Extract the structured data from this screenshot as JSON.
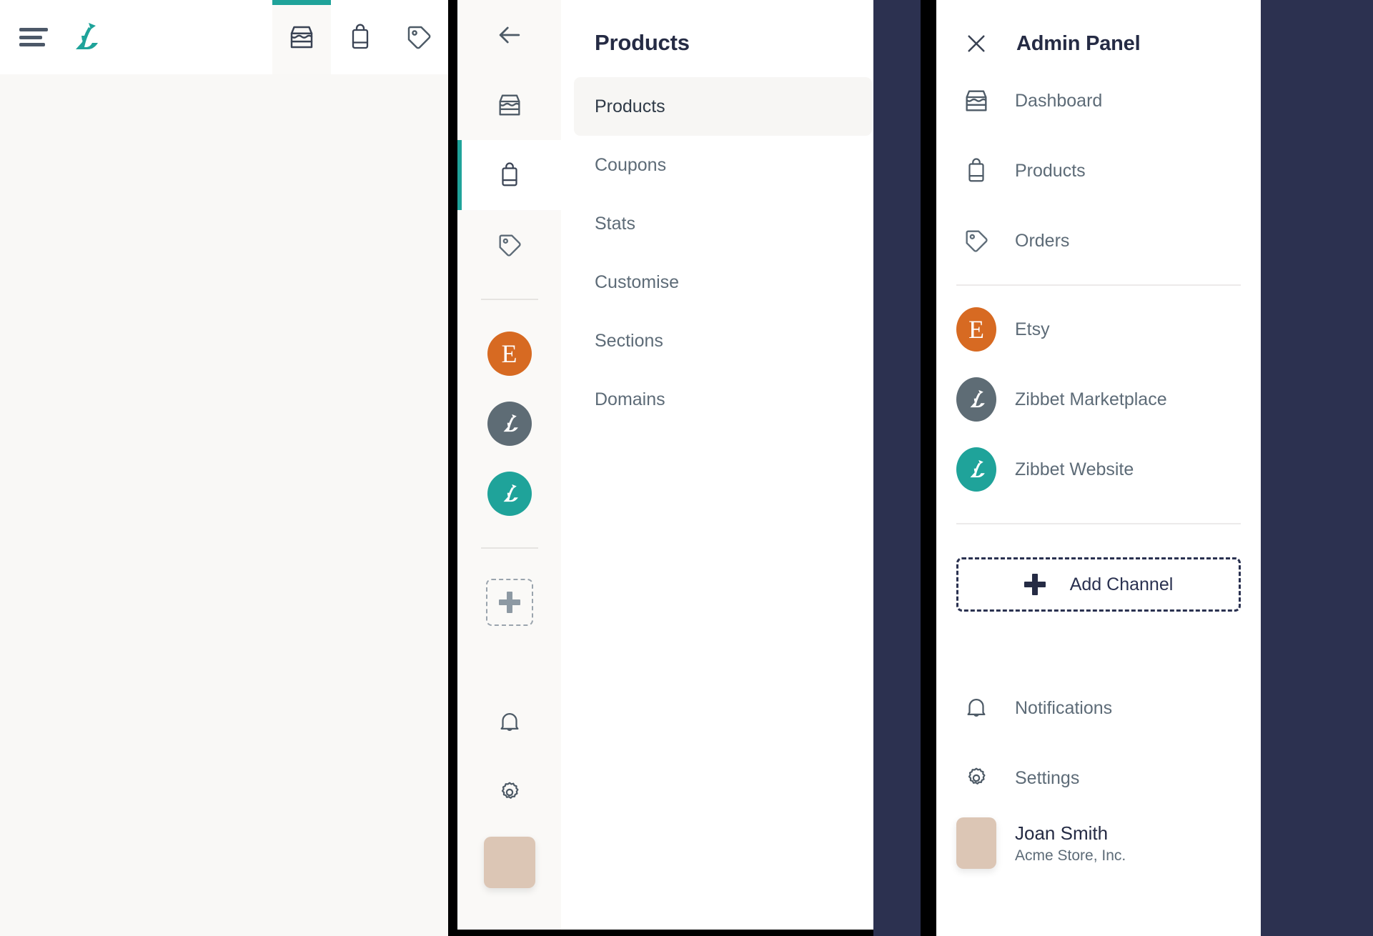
{
  "colors": {
    "teal": "#1fa39a",
    "etsy_orange": "#d76a22",
    "marketplace_grey": "#5e6c75",
    "website_teal": "#1fa39a",
    "navy_backdrop": "#2c3150",
    "text_dark": "#252b44",
    "text_muted": "#5d6b77",
    "avatar_tan": "#dcc6b5"
  },
  "panel1": {
    "menu_icon": "hamburger-icon",
    "logo_icon": "zibbet-swan-logo",
    "tabs": [
      {
        "icon": "storefront-icon",
        "name": "dashboard",
        "active": true
      },
      {
        "icon": "shopping-bag-icon",
        "name": "products",
        "active": false
      },
      {
        "icon": "price-tag-icon",
        "name": "orders",
        "active": false
      }
    ]
  },
  "panel2": {
    "back_icon": "back-arrow-icon",
    "title": "Products",
    "rail": {
      "nav_icons": [
        {
          "icon": "storefront-icon",
          "name": "dashboard",
          "active": false,
          "tinted": true
        },
        {
          "icon": "shopping-bag-icon",
          "name": "products",
          "active": true,
          "tinted": false
        },
        {
          "icon": "price-tag-icon",
          "name": "orders",
          "active": false,
          "tinted": true
        }
      ],
      "channels": [
        {
          "name": "Etsy",
          "type": "letter",
          "glyph": "E",
          "color": "#d76a22"
        },
        {
          "name": "Zibbet Marketplace",
          "type": "swan",
          "color": "#5e6c75"
        },
        {
          "name": "Zibbet Website",
          "type": "swan",
          "color": "#1fa39a"
        }
      ],
      "add_icon": "plus-icon",
      "bell_icon": "bell-icon",
      "gear_icon": "gear-icon",
      "avatar_icon": "user-avatar"
    },
    "menu_items": [
      {
        "label": "Products",
        "selected": true
      },
      {
        "label": "Coupons",
        "selected": false
      },
      {
        "label": "Stats",
        "selected": false
      },
      {
        "label": "Customise",
        "selected": false
      },
      {
        "label": "Sections",
        "selected": false
      },
      {
        "label": "Domains",
        "selected": false
      }
    ]
  },
  "panel3": {
    "close_icon": "close-icon",
    "title": "Admin Panel",
    "nav_items": [
      {
        "label": "Dashboard",
        "icon": "storefront-icon"
      },
      {
        "label": "Products",
        "icon": "shopping-bag-icon"
      },
      {
        "label": "Orders",
        "icon": "price-tag-icon"
      }
    ],
    "channels": [
      {
        "label": "Etsy",
        "type": "letter",
        "glyph": "E",
        "color": "#d76a22"
      },
      {
        "label": "Zibbet Marketplace",
        "type": "swan",
        "color": "#5e6c75"
      },
      {
        "label": "Zibbet Website",
        "type": "swan",
        "color": "#1fa39a"
      }
    ],
    "add_channel_label": "Add Channel",
    "add_channel_icon": "plus-icon",
    "footer_items": [
      {
        "label": "Notifications",
        "icon": "bell-icon"
      },
      {
        "label": "Settings",
        "icon": "gear-icon"
      }
    ],
    "user": {
      "name": "Joan Smith",
      "org": "Acme Store, Inc.",
      "avatar_icon": "user-avatar"
    }
  }
}
